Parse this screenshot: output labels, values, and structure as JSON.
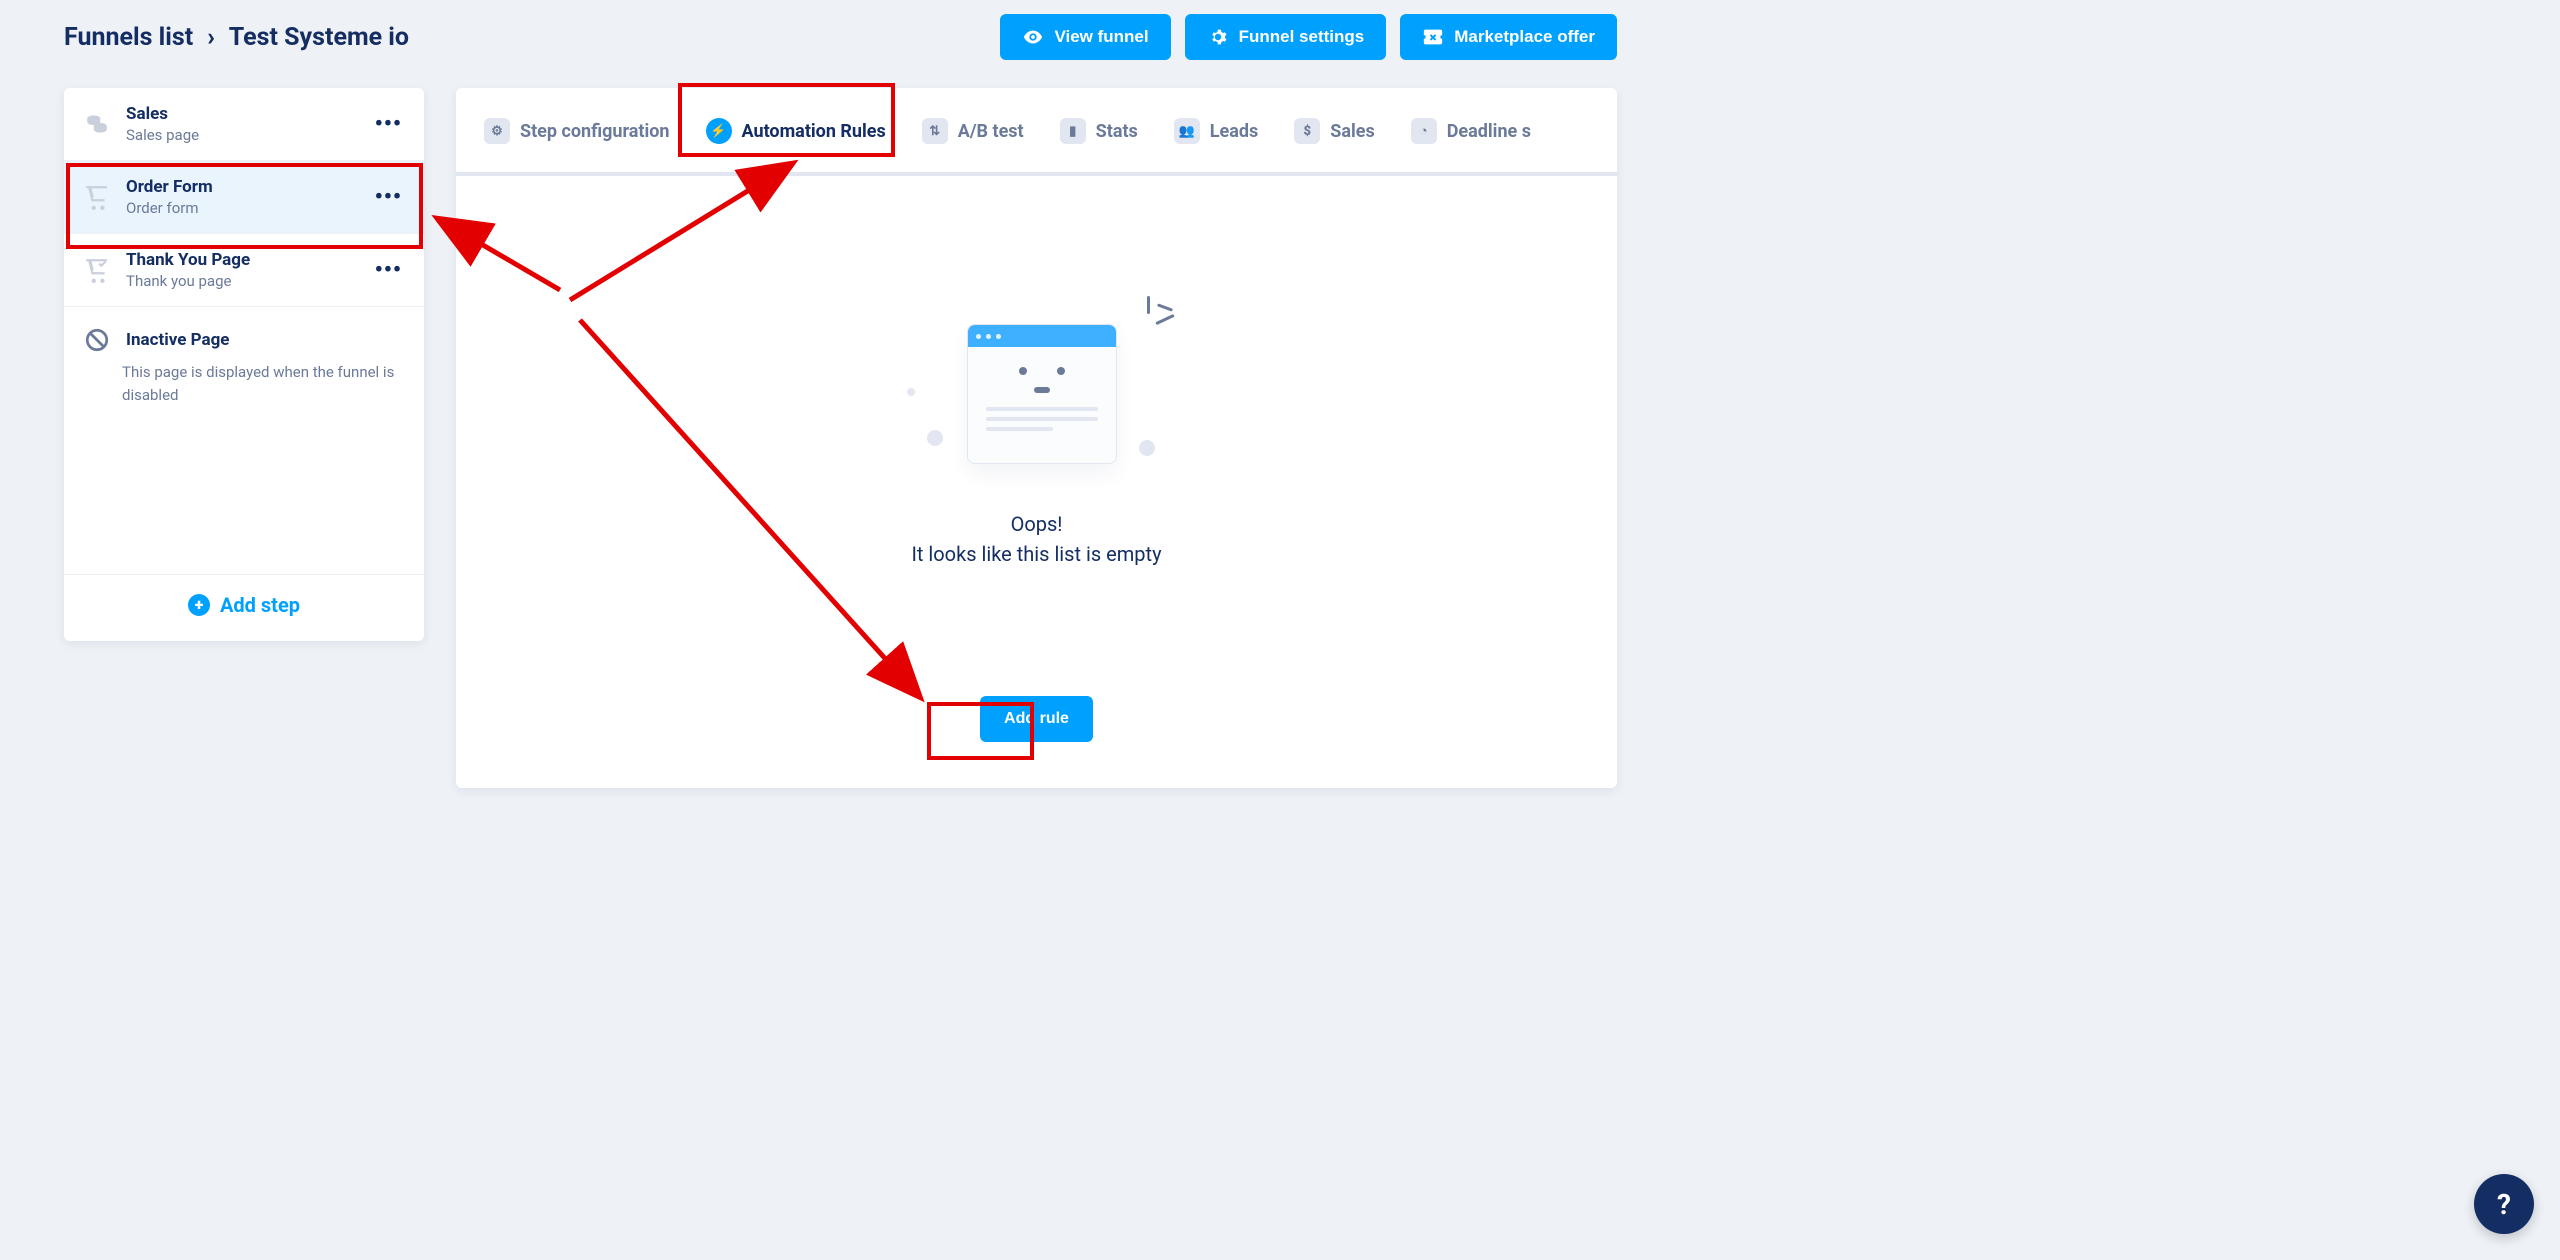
{
  "breadcrumb": {
    "root": "Funnels list",
    "current": "Test Systeme io"
  },
  "header_buttons": {
    "view": "View funnel",
    "settings": "Funnel settings",
    "marketplace": "Marketplace offer"
  },
  "sidebar": {
    "steps": [
      {
        "title": "Sales",
        "sub": "Sales page"
      },
      {
        "title": "Order Form",
        "sub": "Order form"
      },
      {
        "title": "Thank You Page",
        "sub": "Thank you page"
      }
    ],
    "inactive": {
      "title": "Inactive Page",
      "desc": "This page is displayed when the funnel is disabled"
    },
    "add_step": "Add step"
  },
  "tabs": [
    {
      "label": "Step configuration",
      "glyph": "⚙"
    },
    {
      "label": "Automation Rules",
      "glyph": "⚡"
    },
    {
      "label": "A/B test",
      "glyph": "⇅"
    },
    {
      "label": "Stats",
      "glyph": "▮"
    },
    {
      "label": "Leads",
      "glyph": "👥"
    },
    {
      "label": "Sales",
      "glyph": "$"
    },
    {
      "label": "Deadline s",
      "glyph": "◔"
    }
  ],
  "empty": {
    "title": "Oops!",
    "sub": "It looks like this list is empty"
  },
  "add_rule": "Add rule",
  "help": "?"
}
